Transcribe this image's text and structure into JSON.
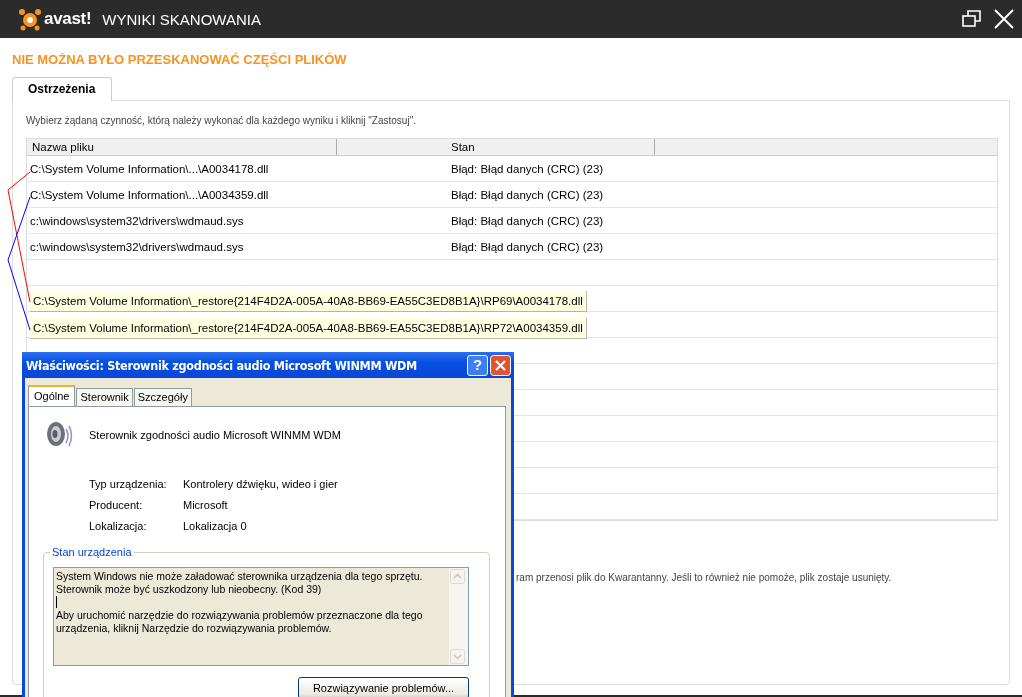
{
  "app": {
    "logo": "avast!",
    "title": "WYNIKI SKANOWANIA"
  },
  "heading": "NIE MOŻNA BYŁO PRZESKANOWAĆ CZĘŚCI PLIKÓW",
  "tabs": [
    {
      "label": "Ostrzeżenia",
      "selected": true
    }
  ],
  "instruction": "Wybierz żądaną czynność, którą należy wykonać dla każdego wyniku i kliknij \"Zastosuj\".",
  "table": {
    "columns": [
      "Nazwa pliku",
      "Stan"
    ],
    "rows": [
      {
        "file": "C:\\System Volume Information\\...\\A0034178.dll",
        "status": "Błąd: Błąd danych (CRC) (23)"
      },
      {
        "file": "C:\\System Volume Information\\...\\A0034359.dll",
        "status": "Błąd: Błąd danych (CRC) (23)"
      },
      {
        "file": "c:\\windows\\system32\\drivers\\wdmaud.sys",
        "status": "Błąd: Błąd danych (CRC) (23)"
      },
      {
        "file": "c:\\windows\\system32\\drivers\\wdmaud.sys",
        "status": "Błąd: Błąd danych (CRC) (23)"
      }
    ]
  },
  "tooltips": [
    "C:\\System Volume Information\\_restore{214F4D2A-005A-40A8-BB69-EA55C3ED8B1A}\\RP69\\A0034178.dll",
    "C:\\System Volume Information\\_restore{214F4D2A-005A-40A8-BB69-EA55C3ED8B1A}\\RP72\\A0034359.dll"
  ],
  "note": "ram przenosi plik do Kwarantanny. Jeśli to również nie pomoże, plik zostaje usunięty.",
  "dialog": {
    "title": "Właściwości: Sterownik zgodności audio Microsoft WINMM WDM",
    "help": "?",
    "tabs": [
      {
        "label": "Ogólne",
        "selected": true
      },
      {
        "label": "Sterownik",
        "selected": false
      },
      {
        "label": "Szczegóły",
        "selected": false
      }
    ],
    "device_name": "Sterownik zgodności audio Microsoft WINMM WDM",
    "properties": [
      {
        "label": "Typ urządzenia:",
        "value": "Kontrolery dźwięku, wideo i gier"
      },
      {
        "label": "Producent:",
        "value": "Microsoft"
      },
      {
        "label": "Lokalizacja:",
        "value": "Lokalizacja 0"
      }
    ],
    "status_group": "Stan urządzenia",
    "status_text": [
      [
        "System Windows nie może załadować sterownika urządzenia dla tego sprzętu.",
        "Sterownik może być uszkodzony lub nieobecny. (Kod 39)"
      ],
      [
        "Aby uruchomić narzędzie do rozwiązywania problemów przeznaczone dla tego",
        "urządzenia, kliknij Narzędzie do rozwiązywania problemów."
      ]
    ],
    "troubleshoot_button": "Rozwiązywanie problemów..."
  }
}
